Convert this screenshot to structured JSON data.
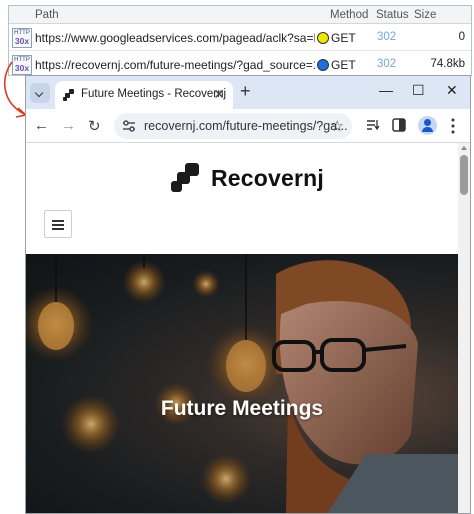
{
  "netlog": {
    "columns": {
      "path": "Path",
      "method": "Method",
      "status": "Status",
      "size": "Size"
    },
    "rows": [
      {
        "icon_top": "HTTP",
        "icon_code": "30x",
        "path": "https://www.googleadservices.com/pagead/aclk?sa=L&ai...",
        "method": "GET",
        "method_dot_color": "#f2e500",
        "status": "302",
        "size": "0"
      },
      {
        "icon_top": "HTTP",
        "icon_code": "30x",
        "path": "https://recovernj.com/future-meetings/?gad_source=1&...",
        "method": "GET",
        "method_dot_color": "#1d6fd9",
        "status": "302",
        "size": "74.8kb"
      }
    ]
  },
  "browser": {
    "tab": {
      "title": "Future Meetings - Recovernj",
      "close": "✕"
    },
    "new_tab": "+",
    "window_controls": {
      "minimize": "—",
      "maximize": "☐",
      "close": "✕"
    },
    "toolbar": {
      "back": "←",
      "forward": "→",
      "reload": "↻",
      "url": "recovernj.com/future-meetings/?ga...",
      "star": "☆"
    },
    "accent_color": "#1a56c8"
  },
  "page": {
    "logo_text": "Recovernj",
    "hero_title": "Future Meetings"
  },
  "icons": [
    "redirect-icon",
    "chevron-down-icon",
    "favicon-icon",
    "close-icon",
    "plus-icon",
    "minimize-icon",
    "maximize-icon",
    "back-arrow-icon",
    "forward-arrow-icon",
    "reload-icon",
    "tune-icon",
    "star-icon",
    "reading-list-icon",
    "side-panel-icon",
    "profile-icon",
    "menu-kebab-icon",
    "hamburger-icon"
  ]
}
